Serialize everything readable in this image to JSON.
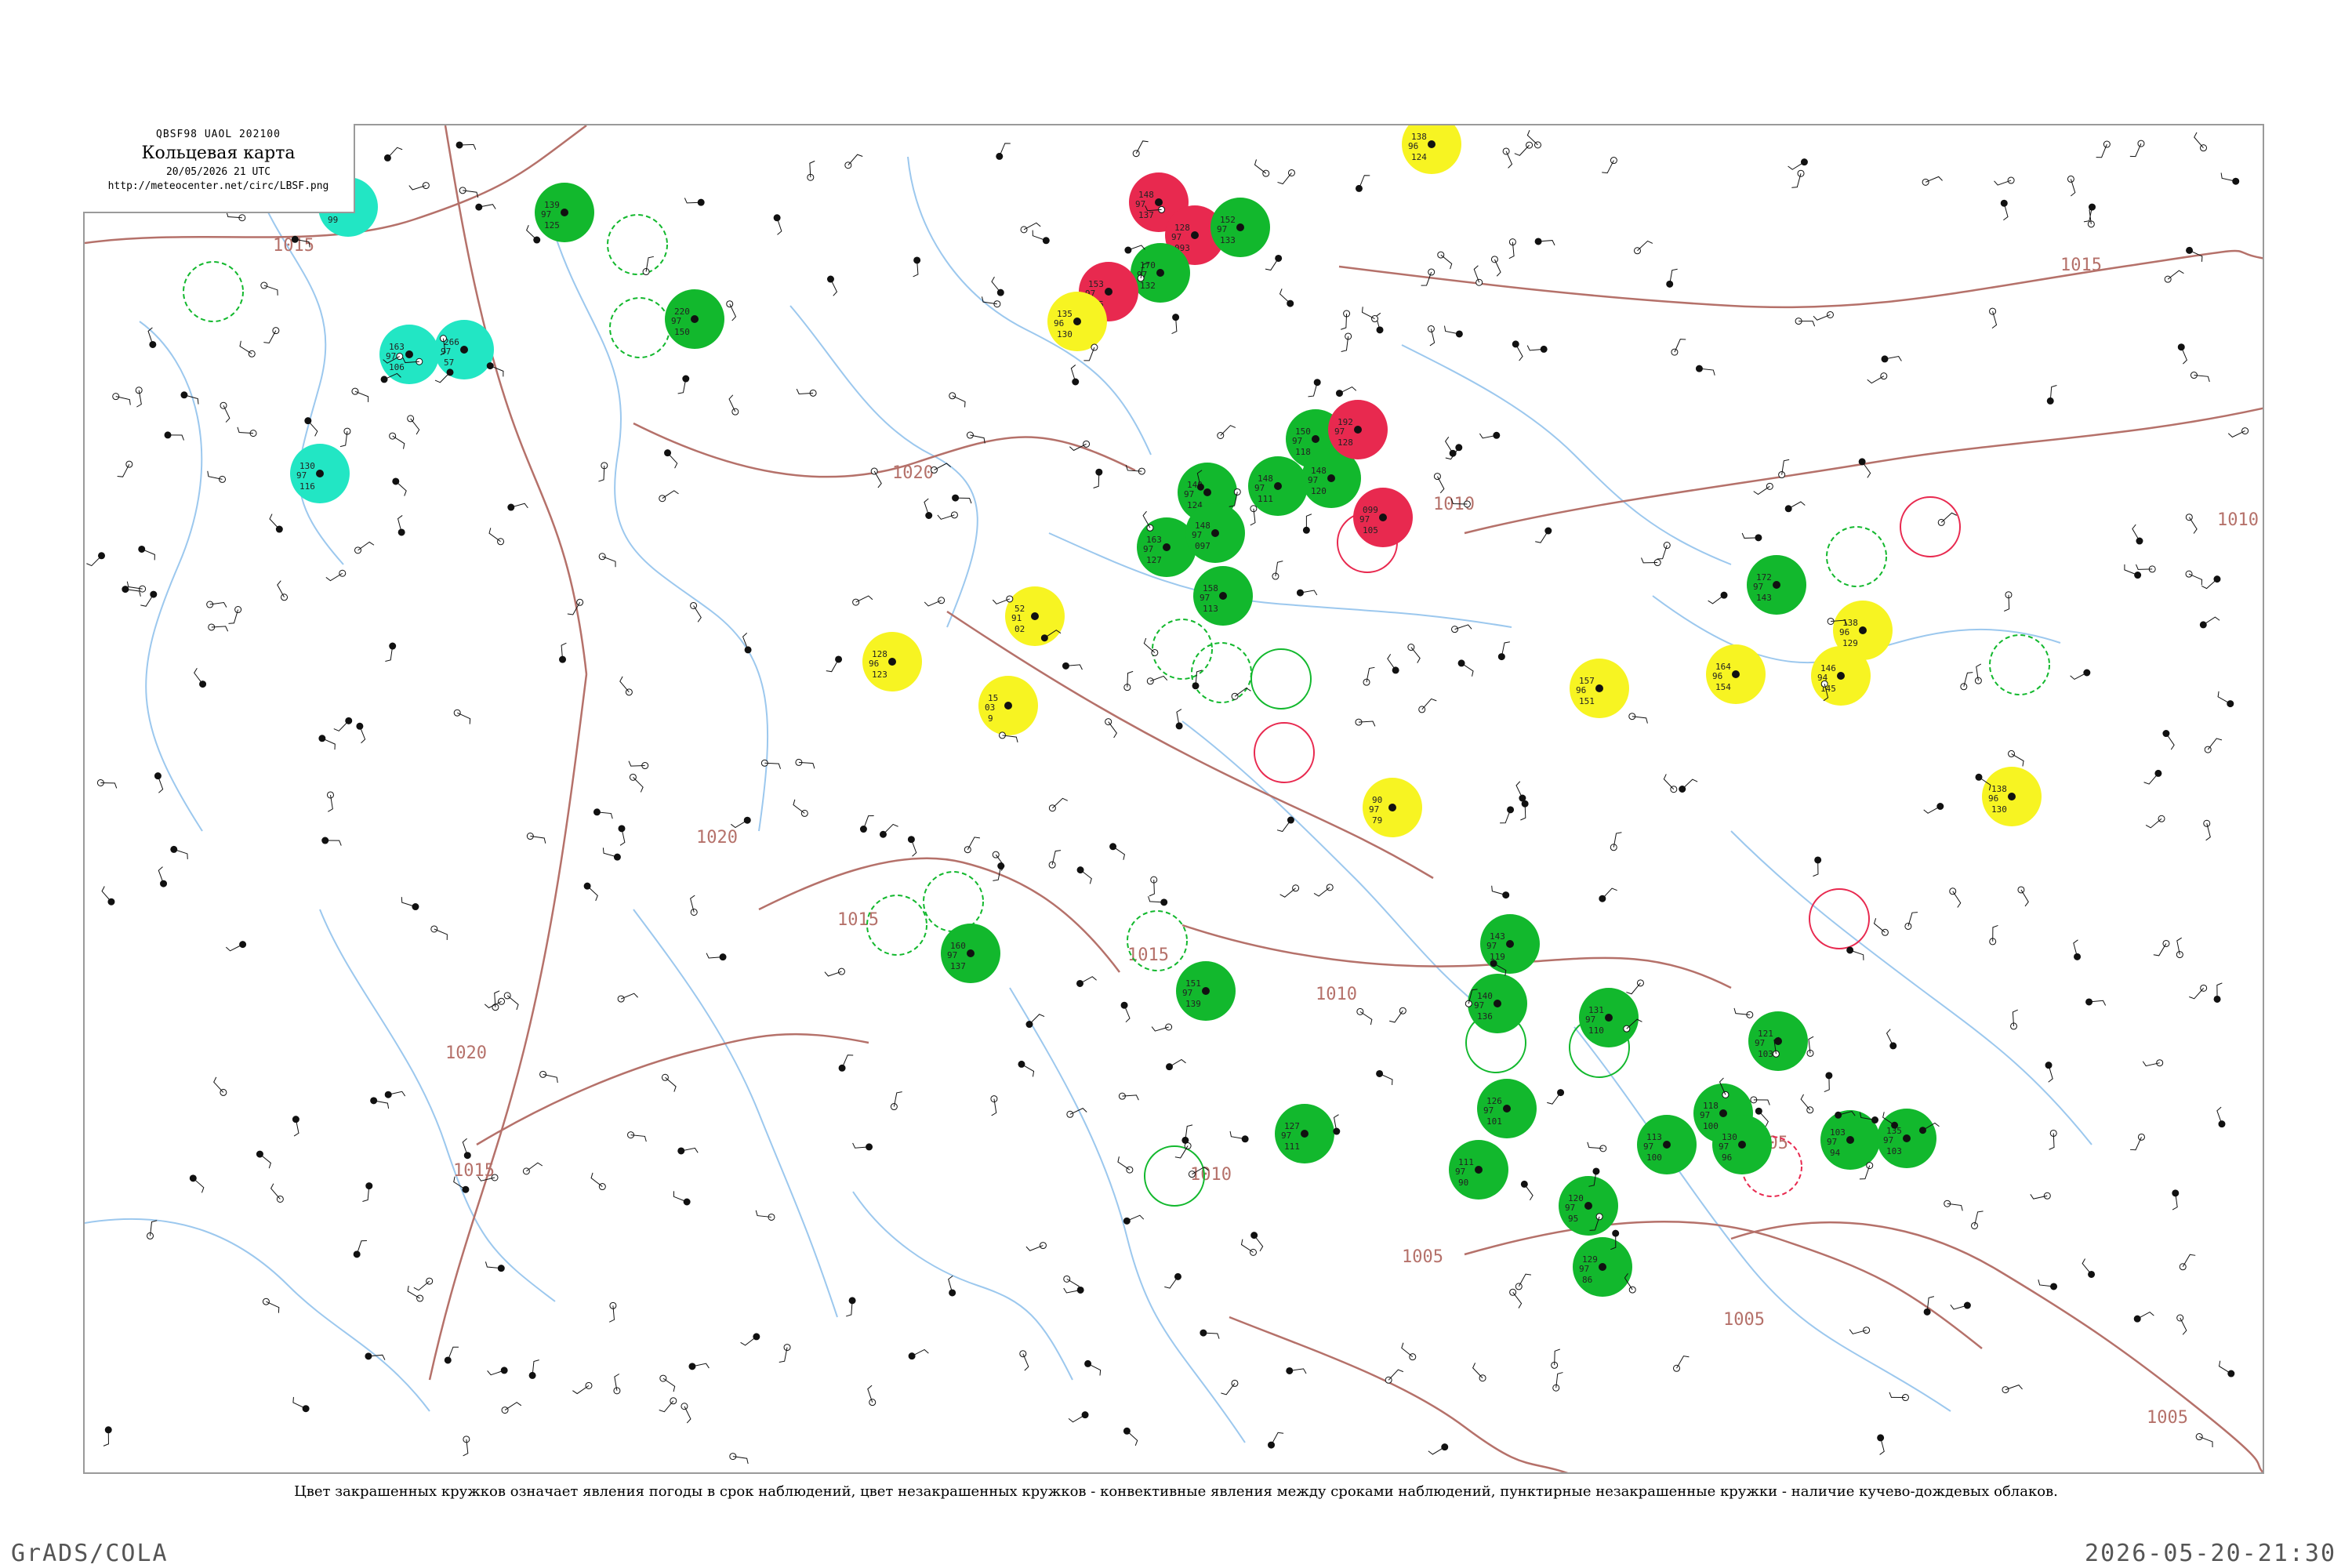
{
  "header": {
    "code": "QBSF98  UAOL  202100",
    "title": "Кольцевая карта",
    "datetime": "20/05/2026 21 UTC",
    "url": "http://meteocenter.net/circ/LBSF.png"
  },
  "legend_note": "Цвет закрашенных кружков означает явления погоды в срок наблюдений, цвет незакрашенных кружков - конвективные явления между сроками наблюдений, пунктирные незакрашенные кружки - наличие кучево-дождевых облаков.",
  "footer": {
    "left": "GrADS/COLA",
    "right": "2026-05-20-21:30"
  },
  "colors": {
    "green": "#12b82d",
    "red": "#e8294f",
    "yellow": "#f7f422",
    "cyan": "#22e6c4",
    "isobar": "#b5716a",
    "water": "#9cc8ee"
  },
  "isobar_labels": [
    "1015",
    "1020",
    "1020",
    "1015",
    "1015",
    "1010",
    "1010",
    "1010",
    "1020",
    "1005",
    "1005",
    "1005",
    "1015",
    "1010",
    "1015",
    "1005"
  ],
  "stations": {
    "filled": [
      {
        "color": "green",
        "nums": [
          "139",
          "97",
          "125"
        ]
      },
      {
        "color": "green",
        "nums": [
          "220",
          "97",
          "150"
        ]
      },
      {
        "color": "red",
        "nums": [
          "148",
          "97",
          "137"
        ]
      },
      {
        "color": "red",
        "nums": [
          "128",
          "97",
          "093"
        ]
      },
      {
        "color": "green",
        "nums": [
          "170",
          "97",
          "132"
        ]
      },
      {
        "color": "green",
        "nums": [
          "152",
          "97",
          "133"
        ]
      },
      {
        "color": "red",
        "nums": [
          "153",
          "97",
          "125"
        ]
      },
      {
        "color": "green",
        "nums": [
          "150",
          "97",
          "118"
        ]
      },
      {
        "color": "green",
        "nums": [
          "148",
          "97",
          "111"
        ]
      },
      {
        "color": "green",
        "nums": [
          "148",
          "97",
          "120"
        ]
      },
      {
        "color": "red",
        "nums": [
          "192",
          "97",
          "128"
        ]
      },
      {
        "color": "red",
        "nums": [
          "099",
          "97",
          "105"
        ]
      },
      {
        "color": "green",
        "nums": [
          "140",
          "97",
          "124"
        ]
      },
      {
        "color": "green",
        "nums": [
          "163",
          "97",
          "127"
        ]
      },
      {
        "color": "green",
        "nums": [
          "158",
          "97",
          "113"
        ]
      },
      {
        "color": "green",
        "nums": [
          "148",
          "97",
          "097"
        ]
      },
      {
        "color": "yellow",
        "nums": [
          "138",
          "96",
          "124"
        ]
      },
      {
        "color": "yellow",
        "nums": [
          "135",
          "96",
          "130"
        ]
      },
      {
        "color": "yellow",
        "nums": [
          "52",
          "91",
          "02"
        ]
      },
      {
        "color": "yellow",
        "nums": [
          "128",
          "96",
          "123"
        ]
      },
      {
        "color": "yellow",
        "nums": [
          "15",
          "03",
          "9"
        ]
      },
      {
        "color": "cyan",
        "nums": [
          "135",
          "97",
          "99"
        ]
      },
      {
        "color": "cyan",
        "nums": [
          "163",
          "97",
          "106"
        ]
      },
      {
        "color": "cyan",
        "nums": [
          "130",
          "97",
          "116"
        ]
      },
      {
        "color": "cyan",
        "nums": [
          "266",
          "97",
          "57"
        ]
      },
      {
        "color": "green",
        "nums": [
          "160",
          "97",
          "137"
        ]
      },
      {
        "color": "green",
        "nums": [
          "151",
          "97",
          "139"
        ]
      },
      {
        "color": "green",
        "nums": [
          "143",
          "97",
          "119"
        ]
      },
      {
        "color": "yellow",
        "nums": [
          "90",
          "97",
          "79"
        ]
      },
      {
        "color": "green",
        "nums": [
          "140",
          "97",
          "136"
        ]
      },
      {
        "color": "green",
        "nums": [
          "127",
          "97",
          "111"
        ]
      },
      {
        "color": "green",
        "nums": [
          "131",
          "97",
          "110"
        ]
      },
      {
        "color": "green",
        "nums": [
          "126",
          "97",
          "101"
        ]
      },
      {
        "color": "green",
        "nums": [
          "113",
          "97",
          "100"
        ]
      },
      {
        "color": "green",
        "nums": [
          "118",
          "97",
          "100"
        ]
      },
      {
        "color": "green",
        "nums": [
          "130",
          "97",
          "96"
        ]
      },
      {
        "color": "green",
        "nums": [
          "111",
          "97",
          "90"
        ]
      },
      {
        "color": "green",
        "nums": [
          "120",
          "97",
          "95"
        ]
      },
      {
        "color": "green",
        "nums": [
          "121",
          "97",
          "103"
        ]
      },
      {
        "color": "green",
        "nums": [
          "103",
          "97",
          "94"
        ]
      },
      {
        "color": "green",
        "nums": [
          "135",
          "97",
          "103"
        ]
      },
      {
        "color": "green",
        "nums": [
          "129",
          "97",
          "86"
        ]
      },
      {
        "color": "yellow",
        "nums": [
          "164",
          "96",
          "154"
        ]
      },
      {
        "color": "yellow",
        "nums": [
          "157",
          "96",
          "151"
        ]
      },
      {
        "color": "yellow",
        "nums": [
          "138",
          "96",
          "129"
        ]
      },
      {
        "color": "yellow",
        "nums": [
          "146",
          "94",
          "145"
        ]
      },
      {
        "color": "yellow",
        "nums": [
          "138",
          "96",
          "130"
        ]
      },
      {
        "color": "green",
        "nums": [
          "172",
          "97",
          "143"
        ]
      }
    ]
  }
}
